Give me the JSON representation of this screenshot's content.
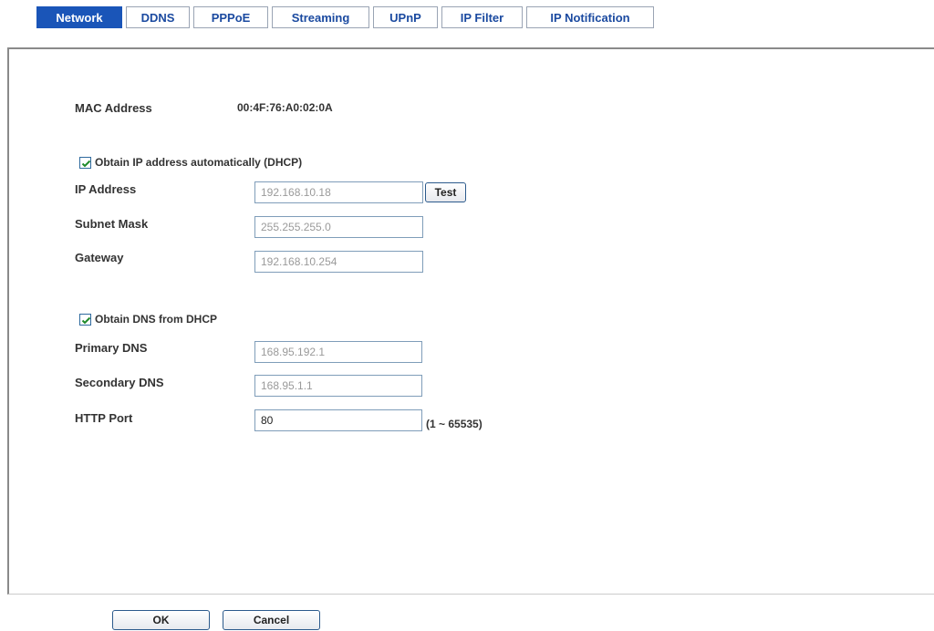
{
  "tabs": {
    "network": "Network",
    "ddns": "DDNS",
    "pppoe": "PPPoE",
    "streaming": "Streaming",
    "upnp": "UPnP",
    "ip_filter": "IP Filter",
    "ip_notification": "IP Notification",
    "active": "Network"
  },
  "colors": {
    "tab_active_bg": "#1a55b8",
    "tab_text": "#1b4aa0",
    "border": "#8a8a8a"
  },
  "form": {
    "mac_label": "MAC Address",
    "mac_value": "00:4F:76:A0:02:0A",
    "dhcp_label": "Obtain IP address automatically (DHCP)",
    "dhcp_checked": true,
    "ip_label": "IP Address",
    "ip_value": "192.168.10.18",
    "test_label": "Test",
    "subnet_label": "Subnet Mask",
    "subnet_value": "255.255.255.0",
    "gateway_label": "Gateway",
    "gateway_value": "192.168.10.254",
    "dns_dhcp_label": "Obtain DNS from DHCP",
    "dns_dhcp_checked": true,
    "primary_dns_label": "Primary DNS",
    "primary_dns_value": "168.95.192.1",
    "secondary_dns_label": "Secondary DNS",
    "secondary_dns_value": "168.95.1.1",
    "http_port_label": "HTTP Port",
    "http_port_value": "80",
    "http_port_hint": "(1 ~ 65535)"
  },
  "actions": {
    "ok_label": "OK",
    "cancel_label": "Cancel"
  }
}
